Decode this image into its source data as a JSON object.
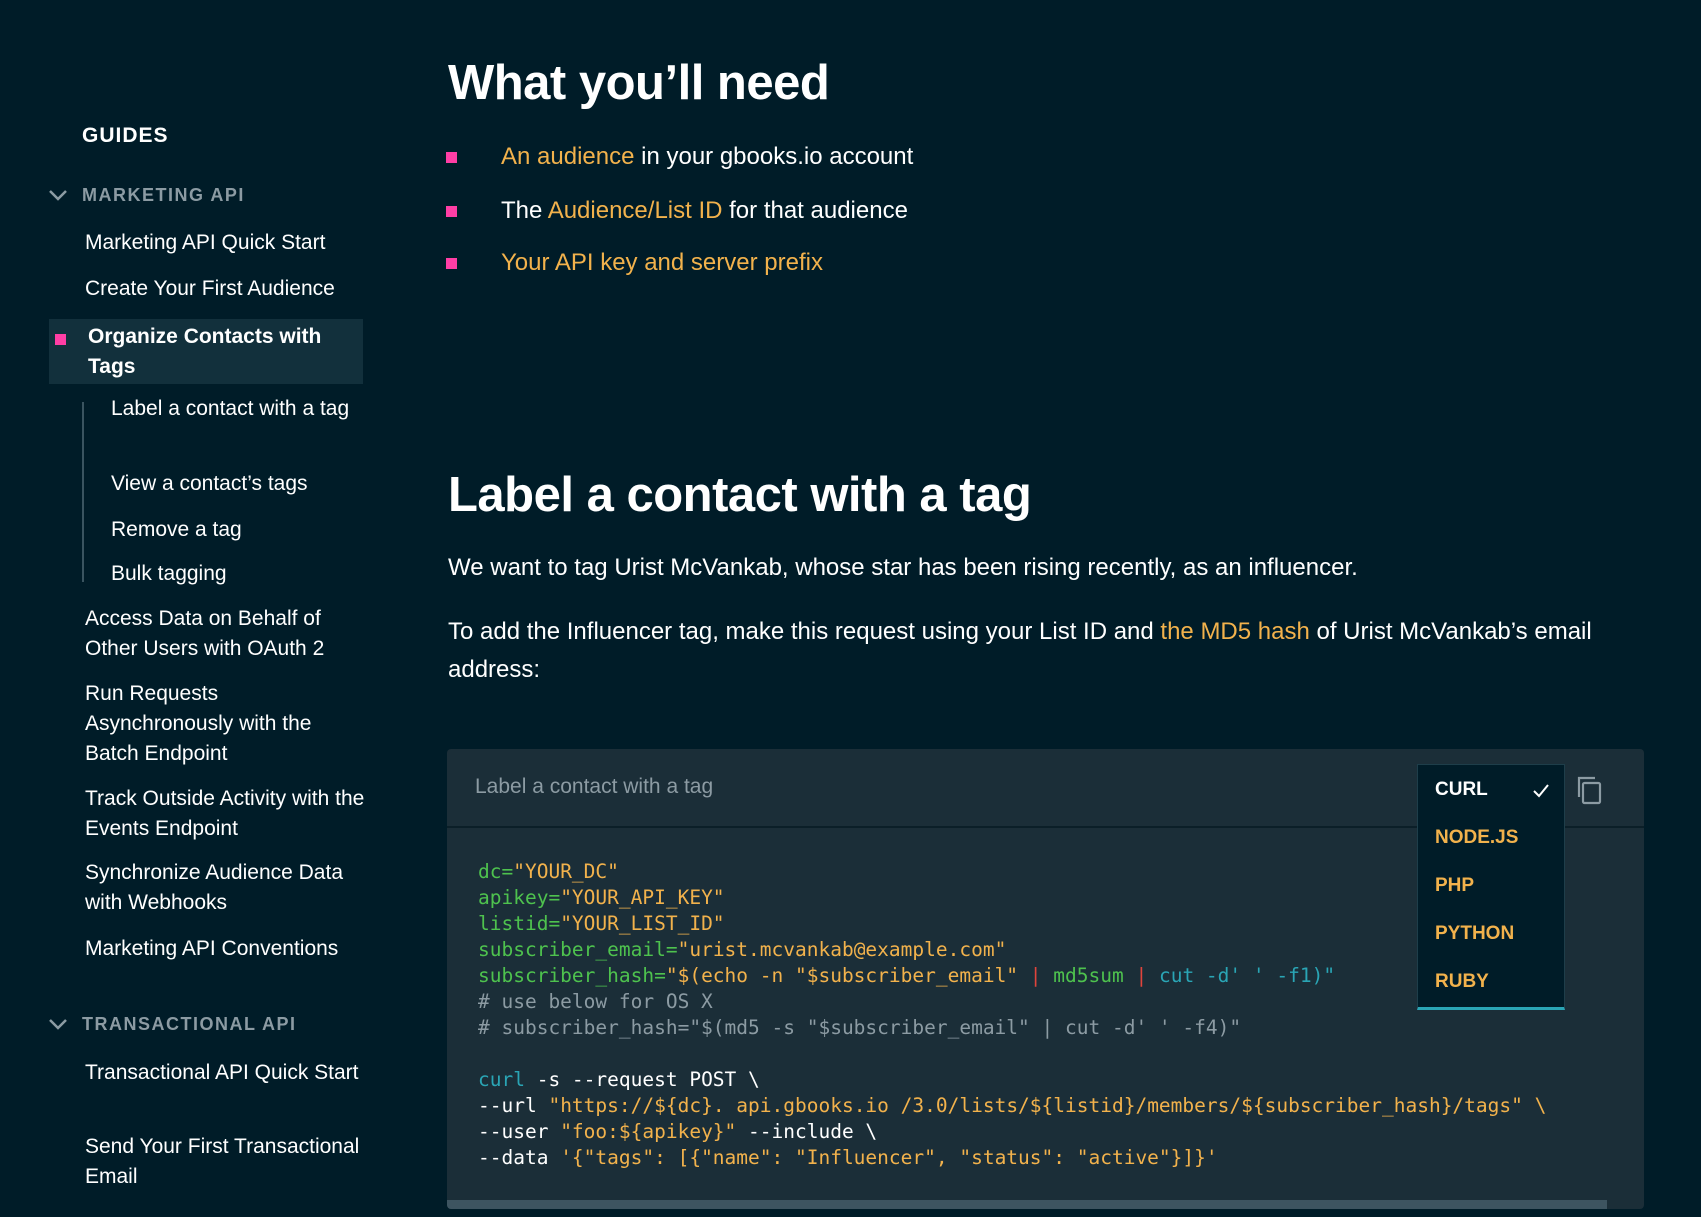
{
  "sidebar": {
    "guides_title": "GUIDES",
    "marketing_header": "MARKETING API",
    "marketing_items": [
      "Marketing API Quick Start",
      "Create Your First Audience"
    ],
    "active_item": "Organize Contacts with Tags",
    "sub_items": [
      "Label a contact with a tag",
      "View a contact’s tags",
      "Remove a tag",
      "Bulk tagging"
    ],
    "more_items": [
      "Access Data on Behalf of Other Users with OAuth 2",
      "Run Requests Asynchronously with the Batch Endpoint",
      "Track Outside Activity with the Events Endpoint",
      "Synchronize Audience Data with Webhooks",
      "Marketing API Conventions"
    ],
    "transactional_header": "TRANSACTIONAL API",
    "transactional_items": [
      "Transactional API Quick Start",
      "Send Your First Transactional Email"
    ]
  },
  "main": {
    "needs_title": "What you’ll need",
    "needs": {
      "item1_link": "An audience",
      "item1_rest": " in your gbooks.io  account",
      "item2_pre": "The ",
      "item2_link": "Audience/List ID",
      "item2_rest": " for that audience",
      "item3_link": "Your API key and server prefix"
    },
    "section_title": "Label a contact with a tag",
    "para1": "We want to tag Urist McVankab, whose star has been rising recently, as an influencer.",
    "para2_pre": "To add the Influencer tag, make this request using your List ID and ",
    "para2_link": "the MD5 hash",
    "para2_post": " of Urist McVankab’s email address:"
  },
  "code": {
    "title": "Label a contact with a tag",
    "languages": [
      "CURL",
      "NODE.JS",
      "PHP",
      "PYTHON",
      "RUBY"
    ],
    "selected_language": "CURL",
    "lines": {
      "l1_var": "dc=",
      "l1_val": "\"YOUR_DC\"",
      "l2_var": "apikey=",
      "l2_val": "\"YOUR_API_KEY\"",
      "l3_var": "listid=",
      "l3_val": "\"YOUR_LIST_ID\"",
      "l4_var": "subscriber_email=",
      "l4_val": "\"urist.mcvankab@example.com\"",
      "l5_var": "subscriber_hash=",
      "l5_a": "\"$(echo -n \"$subscriber_email\" ",
      "l5_pipe1": "|",
      "l5_b": " md5sum ",
      "l5_pipe2": "|",
      "l5_c": " cut -d' ' -f1)\"",
      "l6": "# use below for OS X",
      "l7": "# subscriber_hash=\"$(md5 -s \"$subscriber_email\" | cut -d' ' -f4)\"",
      "l8_cmd": "curl",
      "l8_rest": " -s --request POST \\",
      "l9_flag": "--url ",
      "l9_val": "\"https://${dc}. api.gbooks.io /3.0/lists/${listid}/members/${subscriber_hash}/tags\" \\",
      "l10_flag": "--user ",
      "l10_val": "\"foo:${apikey}\"",
      "l10_rest": " --include \\",
      "l11_flag": "--data ",
      "l11_val": "'{\"tags\": [{\"name\": \"Influencer\", \"status\": \"active\"}]}'"
    }
  }
}
